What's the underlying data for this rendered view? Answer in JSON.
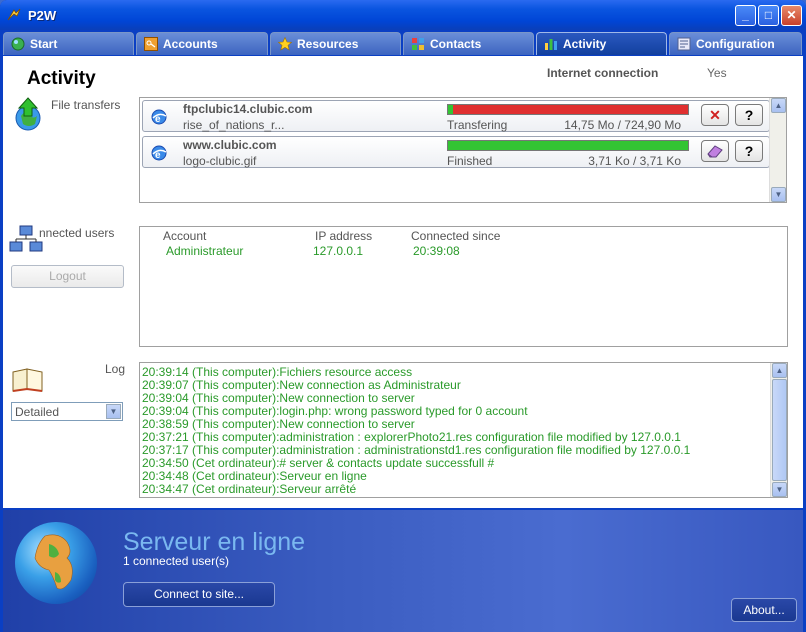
{
  "window": {
    "title": "P2W",
    "minimize": "_",
    "maximize": "□",
    "close": "✕"
  },
  "tabs": [
    {
      "label": "Start",
      "icon": "globe-icon"
    },
    {
      "label": "Accounts",
      "icon": "key-icon"
    },
    {
      "label": "Resources",
      "icon": "star-icon"
    },
    {
      "label": "Contacts",
      "icon": "contacts-icon"
    },
    {
      "label": "Activity",
      "icon": "activity-icon",
      "active": true
    },
    {
      "label": "Configuration",
      "icon": "configuration-icon"
    }
  ],
  "page": {
    "title": "Activity",
    "internet_label": "Internet connection",
    "internet_value": "Yes"
  },
  "transfers": {
    "label": "File transfers",
    "items": [
      {
        "host": "ftpclubic14.clubic.com",
        "file": "rise_of_nations_r...",
        "status": "Transfering",
        "size": "14,75 Mo / 724,90 Mo",
        "progress": 0.02,
        "action": "cancel-icon",
        "action_glyph": "✕",
        "help": "?"
      },
      {
        "host": "www.clubic.com",
        "file": "logo-clubic.gif",
        "status": "Finished",
        "size": "3,71 Ko / 3,71 Ko",
        "progress": 1.0,
        "action": "eraser-icon",
        "action_glyph": "",
        "help": "?"
      }
    ]
  },
  "users": {
    "label": "nnected users",
    "logout": "Logout",
    "headers": [
      "Account",
      "IP address",
      "Connected since"
    ],
    "rows": [
      [
        "Administrateur",
        "127.0.0.1",
        "20:39:08"
      ]
    ]
  },
  "log": {
    "label": "Log",
    "level": "Detailed",
    "lines": [
      "20:39:14 (This computer):Fichiers resource access",
      "20:39:07 (This computer):New connection as Administrateur",
      "20:39:04 (This computer):New connection to server",
      "20:39:04 (This computer):login.php: wrong password typed for 0 account",
      "20:38:59 (This computer):New connection to server",
      "20:37:21 (This computer):administration : explorerPhoto21.res configuration file modified by 127.0.0.1",
      "20:37:17 (This computer):administration : administrationstd1.res configuration file modified by 127.0.0.1",
      "20:34:50 (Cet ordinateur):# server & contacts update successfull #",
      "20:34:48 (Cet ordinateur):Serveur en ligne",
      "20:34:47 (Cet ordinateur):Serveur arrêté"
    ]
  },
  "server": {
    "status": "Serveur en ligne",
    "connected": "1 connected user(s)",
    "connect_btn": "Connect to site...",
    "about_btn": "About..."
  },
  "colors": {
    "log_text": "#2a9a2a",
    "bar_done": "#33c433",
    "bar_remaining": "#e03030"
  }
}
